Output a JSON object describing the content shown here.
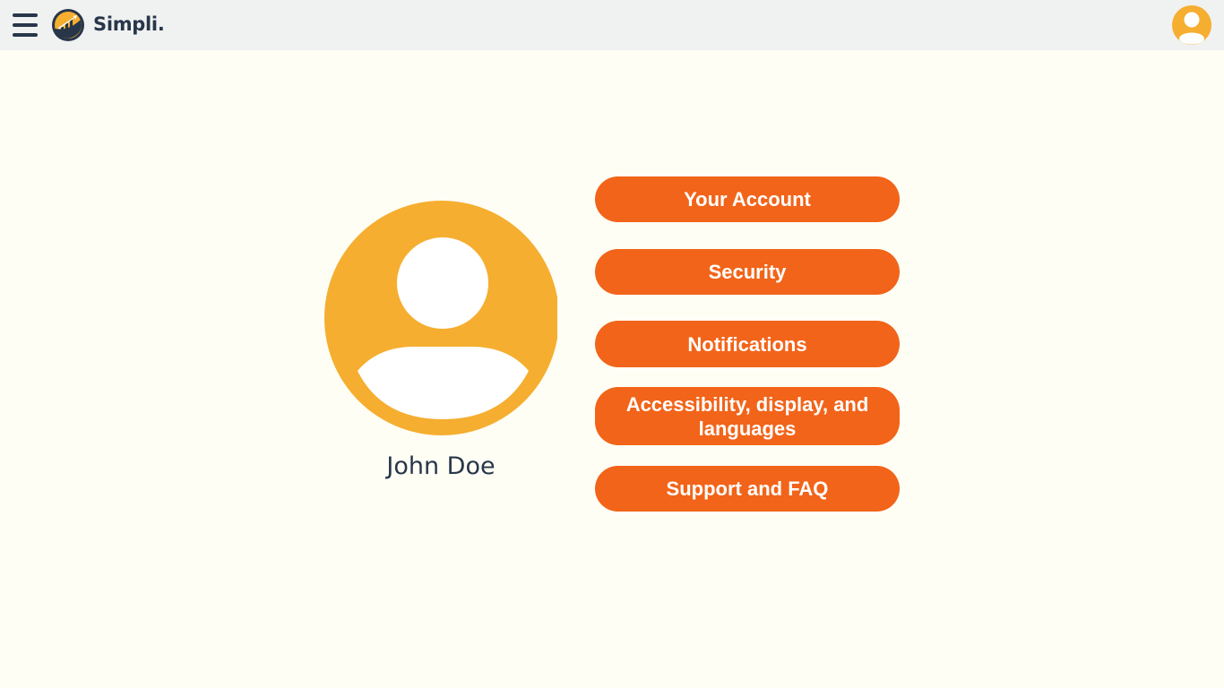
{
  "header": {
    "brand": "Simpli.",
    "icons": {
      "menu": "hamburger-menu-icon",
      "logo": "bar-chart-logo-icon",
      "account": "user-avatar-icon"
    }
  },
  "profile": {
    "name": "John Doe",
    "avatar_icon": "user-avatar-icon"
  },
  "menu": {
    "your_account": "Your Account",
    "security": "Security",
    "notifications": "Notifications",
    "accessibility": "Accessibility, display, and languages",
    "support": "Support and FAQ"
  },
  "colors": {
    "background": "#fffef4",
    "header_background": "#f0f1f1",
    "accent_orange": "#f26419",
    "avatar_yellow": "#f5ae30",
    "text_navy": "#28364a"
  }
}
